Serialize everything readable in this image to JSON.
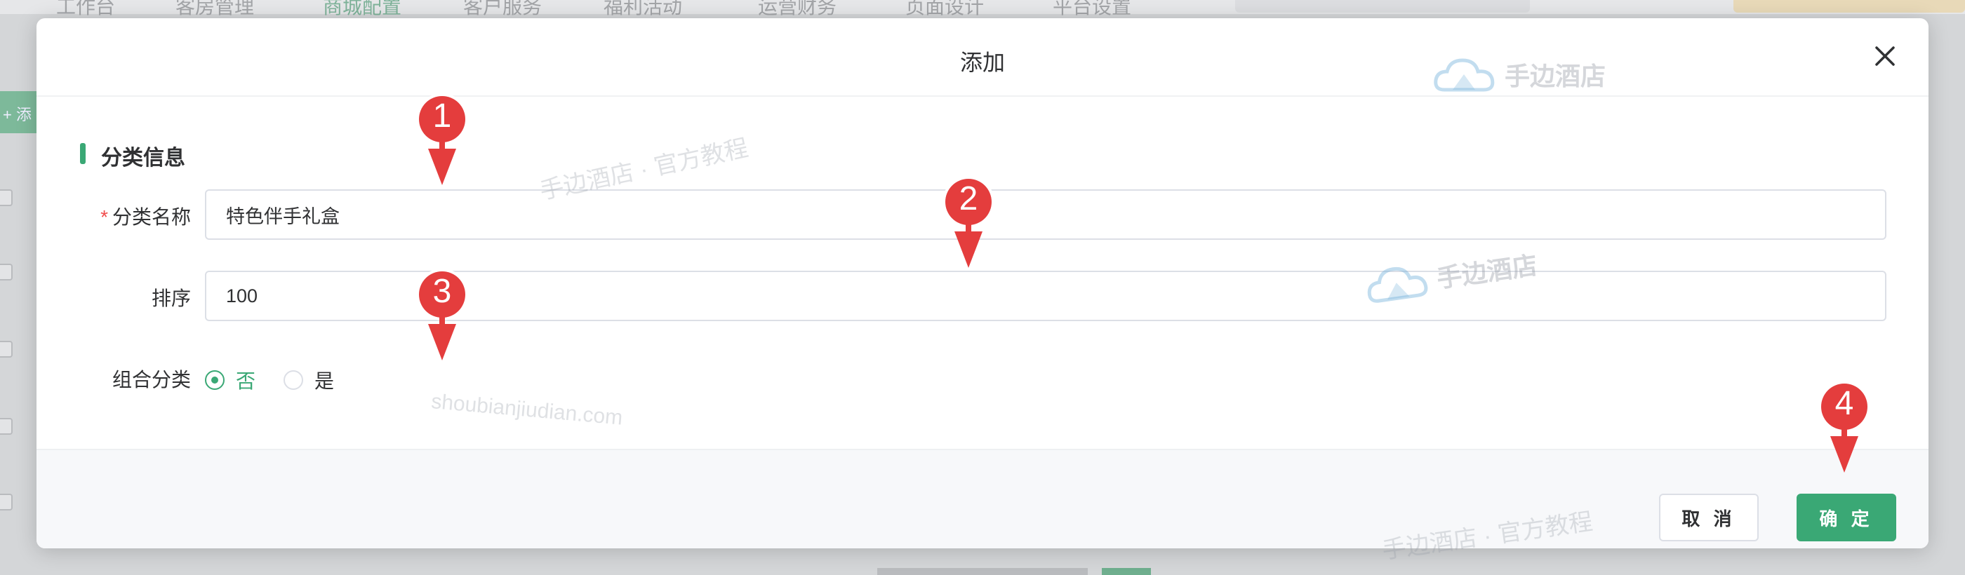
{
  "background": {
    "nav_items": [
      "工作台",
      "客房管理",
      "商城配置",
      "客户服务",
      "福利活动",
      "运营财务",
      "页面设计",
      "平台设置"
    ],
    "add_button_label": "添"
  },
  "dialog": {
    "title": "添加",
    "section_title": "分类信息",
    "fields": {
      "name": {
        "label": "分类名称",
        "required_mark": "*",
        "value": "特色伴手礼盒"
      },
      "sort": {
        "label": "排序",
        "value": "100"
      },
      "combo": {
        "label": "组合分类",
        "options": [
          "否",
          "是"
        ],
        "selected": "否"
      }
    },
    "buttons": {
      "cancel": "取 消",
      "confirm": "确 定"
    }
  },
  "watermarks": {
    "text1": "手边酒店 · 官方教程",
    "text2": "shoubianjiudian.com",
    "text3": "手边酒店 · 官方教程",
    "logo1": "手边酒店",
    "logo2": "手边酒店"
  },
  "markers": [
    "1",
    "2",
    "3",
    "4"
  ],
  "colors": {
    "primary": "#3aa875",
    "required": "#f04d4d",
    "marker": "#e43d3d",
    "close_icon": "#303133"
  }
}
